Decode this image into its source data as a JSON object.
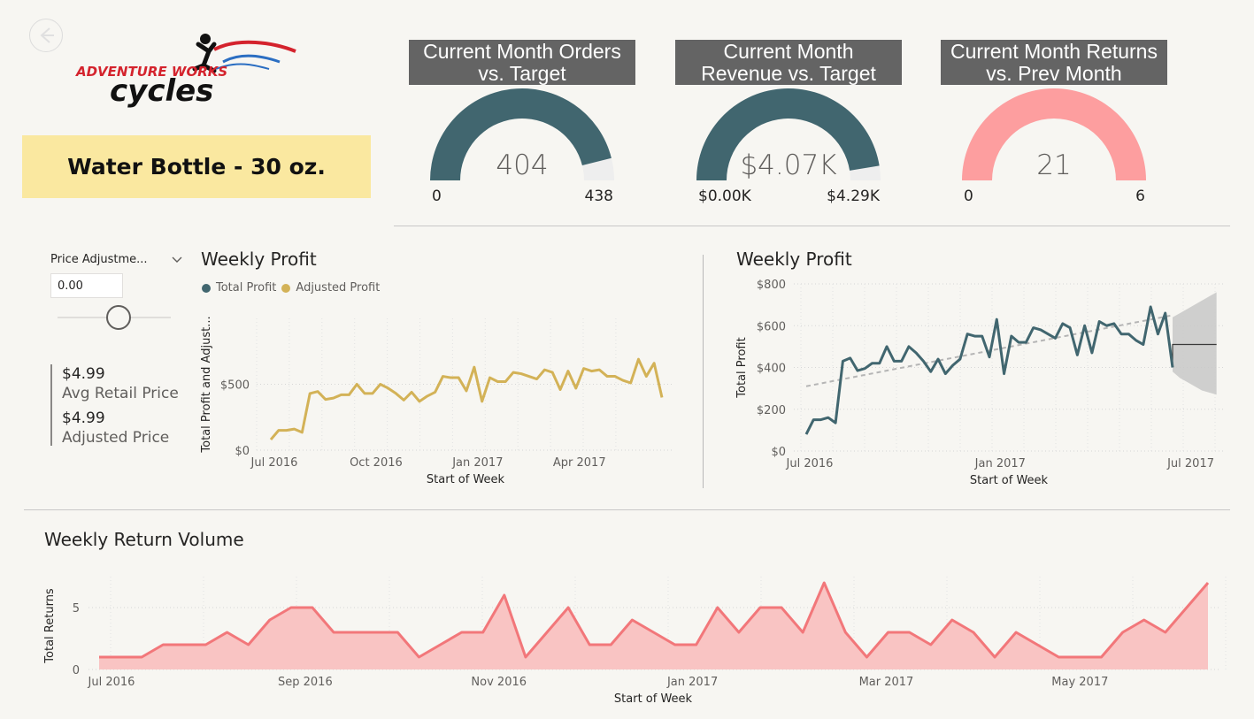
{
  "logo": {
    "brand_line": "ADVENTURE WORKS",
    "name": "cycles"
  },
  "product": {
    "name": "Water Bottle - 30 oz."
  },
  "kpis": [
    {
      "title_line1": "Current Month Orders",
      "title_line2": "vs. Target",
      "value": "404",
      "min": "0",
      "max": "438",
      "fraction": 0.922,
      "color": "#41666f"
    },
    {
      "title_line1": "Current Month",
      "title_line2": "Revenue vs. Target",
      "value": "$4.07K",
      "min": "$0.00K",
      "max": "$4.29K",
      "fraction": 0.949,
      "color": "#41666f"
    },
    {
      "title_line1": "Current Month Returns",
      "title_line2": "vs. Prev Month",
      "value": "21",
      "min": "0",
      "max": "6",
      "fraction": 1.0,
      "color": "#fd9e9f"
    }
  ],
  "slicer": {
    "label": "Price Adjustme...",
    "value": "0.00",
    "slider_fraction": 0.5
  },
  "cards": {
    "avg_price_value": "$4.99",
    "avg_price_label": "Avg Retail Price",
    "adj_price_value": "$4.99",
    "adj_price_label": "Adjusted Price"
  },
  "profit_left": {
    "title": "Weekly Profit",
    "legend": [
      {
        "name": "Total Profit",
        "color": "#41666f"
      },
      {
        "name": "Adjusted Profit",
        "color": "#d3b257"
      }
    ],
    "ylabel": "Total Profit and Adjust...",
    "xlabel": "Start of Week",
    "y_ticks": [
      "$0",
      "$500"
    ],
    "x_ticks": [
      "Jul 2016",
      "Oct 2016",
      "Jan 2017",
      "Apr 2017"
    ]
  },
  "profit_right": {
    "title": "Weekly Profit",
    "ylabel": "Total Profit",
    "xlabel": "Start of Week",
    "y_ticks": [
      "$0",
      "$200",
      "$400",
      "$600",
      "$800"
    ],
    "x_ticks": [
      "Jul 2016",
      "Jan 2017",
      "Jul 2017"
    ]
  },
  "returns": {
    "title": "Weekly Return Volume",
    "ylabel": "Total Returns",
    "xlabel": "Start of Week",
    "y_ticks": [
      "0",
      "5"
    ],
    "x_ticks": [
      "Jul 2016",
      "Sep 2016",
      "Nov 2016",
      "Jan 2017",
      "Mar 2017",
      "May 2017"
    ]
  },
  "chart_data": [
    {
      "type": "line",
      "title": "Weekly Profit",
      "xlabel": "Start of Week",
      "ylabel": "Total Profit and Adjust...",
      "ylim": [
        0,
        1000
      ],
      "x_start": "2016-06-27",
      "x_step_days": 7,
      "series": [
        {
          "name": "Adjusted Profit",
          "values": [
            80,
            150,
            150,
            160,
            135,
            430,
            445,
            385,
            395,
            420,
            420,
            500,
            430,
            430,
            500,
            470,
            430,
            380,
            440,
            370,
            410,
            440,
            560,
            550,
            550,
            450,
            630,
            370,
            550,
            520,
            520,
            590,
            580,
            560,
            540,
            610,
            590,
            460,
            600,
            470,
            620,
            600,
            610,
            560,
            560,
            530,
            510,
            690,
            560,
            660,
            400
          ]
        }
      ]
    },
    {
      "type": "line",
      "title": "Weekly Profit",
      "xlabel": "Start of Week",
      "ylabel": "Total Profit",
      "ylim": [
        0,
        800
      ],
      "x_start": "2016-06-27",
      "x_step_days": 7,
      "series": [
        {
          "name": "Total Profit",
          "values": [
            80,
            150,
            150,
            160,
            135,
            430,
            445,
            385,
            395,
            420,
            420,
            500,
            430,
            430,
            500,
            470,
            430,
            380,
            440,
            370,
            410,
            440,
            560,
            550,
            550,
            450,
            630,
            370,
            550,
            520,
            520,
            590,
            580,
            560,
            540,
            610,
            590,
            460,
            600,
            470,
            620,
            600,
            610,
            560,
            560,
            530,
            510,
            690,
            560,
            660,
            400
          ]
        },
        {
          "name": "Trend",
          "values_start_end": [
            310,
            650
          ]
        },
        {
          "name": "Forecast",
          "values": [
            510,
            510,
            510,
            510,
            510,
            510,
            510
          ],
          "upper": [
            640,
            660,
            680,
            700,
            720,
            740,
            760
          ],
          "lower": [
            380,
            350,
            330,
            310,
            290,
            280,
            270
          ]
        }
      ]
    },
    {
      "type": "area",
      "title": "Weekly Return Volume",
      "xlabel": "Start of Week",
      "ylabel": "Total Returns",
      "ylim": [
        0,
        7.5
      ],
      "x_start": "2016-06-27",
      "x_step_days": 7,
      "series": [
        {
          "name": "Total Returns",
          "values": [
            1,
            1,
            1,
            2,
            2,
            2,
            3,
            2,
            4,
            5,
            5,
            3,
            3,
            3,
            3,
            1,
            2,
            3,
            3,
            6,
            1,
            3,
            5,
            2,
            2,
            4,
            3,
            2,
            2,
            5,
            3,
            5,
            5,
            3,
            7,
            3,
            1,
            3,
            3,
            2,
            4,
            3,
            1,
            3,
            2,
            1,
            1,
            1,
            3,
            4,
            3,
            5,
            7
          ]
        }
      ]
    }
  ]
}
